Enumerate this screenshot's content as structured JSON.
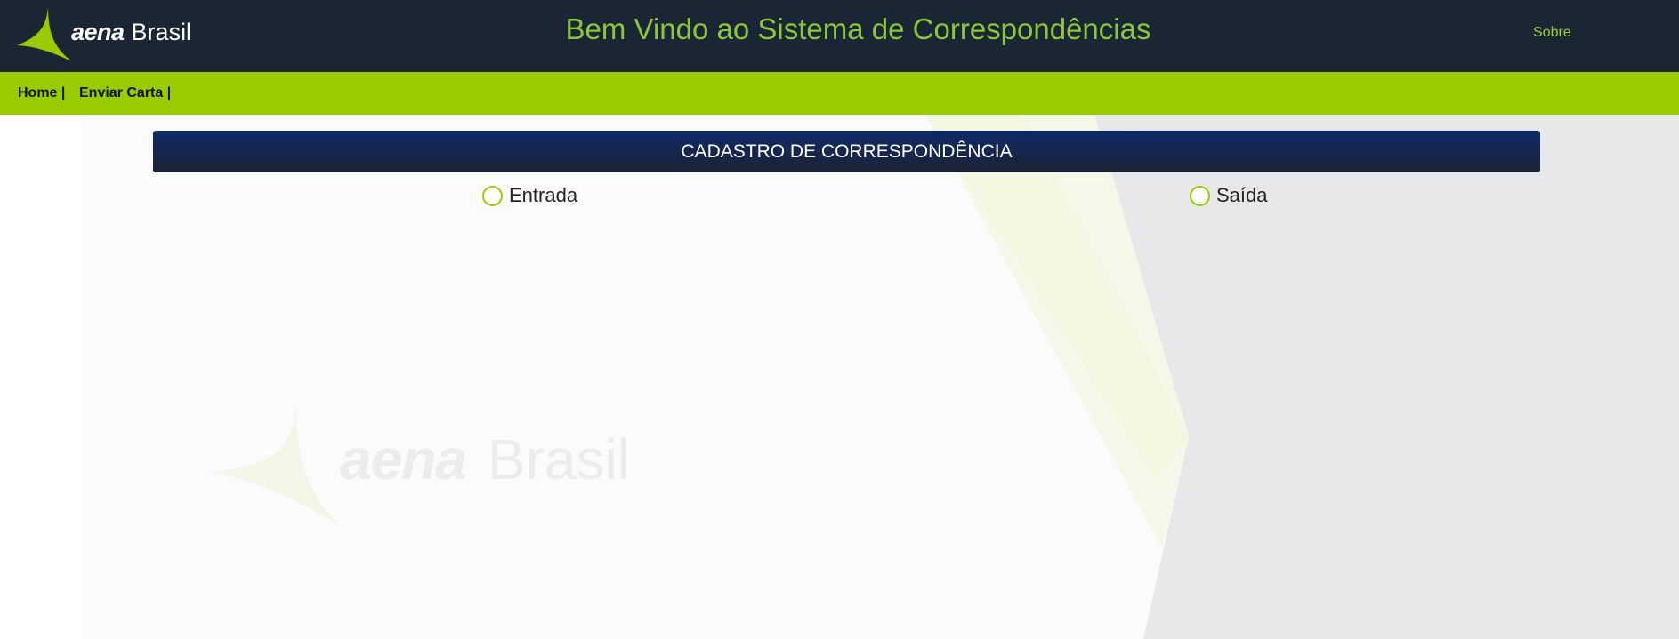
{
  "header": {
    "logo": {
      "brand": "aena",
      "region": "Brasil"
    },
    "title": "Bem Vindo ao Sistema de Correspondências",
    "about_link": "Sobre"
  },
  "nav": {
    "items": [
      {
        "label": "Home |"
      },
      {
        "label": "Enviar Carta |"
      }
    ]
  },
  "panel": {
    "title": "CADASTRO DE CORRESPONDÊNCIA",
    "options": [
      {
        "label": "Entrada",
        "selected": false
      },
      {
        "label": "Saída",
        "selected": false
      }
    ]
  },
  "watermark": {
    "brand": "aena",
    "region": "Brasil"
  },
  "colors": {
    "header_bg": "#1b2634",
    "accent_green": "#99cc00",
    "title_green": "#8cc63f",
    "panel_header": "#0f2a6a"
  },
  "icons": [
    "aena-logo-icon",
    "radio-icon"
  ]
}
